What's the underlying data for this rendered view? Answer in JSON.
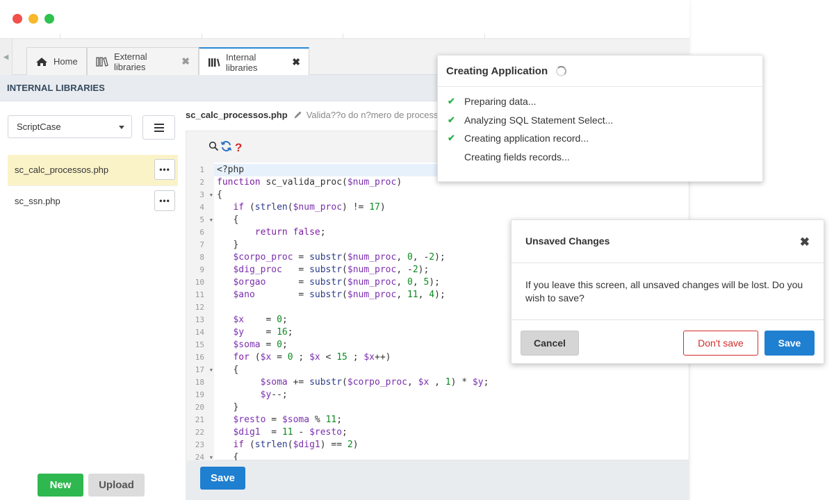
{
  "tabs": [
    {
      "label": "Home",
      "icon": "home-icon",
      "closable": false
    },
    {
      "label": "External libraries",
      "icon": "library-icon",
      "closable": true
    },
    {
      "label": "Internal libraries",
      "icon": "books-icon",
      "closable": true,
      "active": true
    }
  ],
  "section_title": "INTERNAL LIBRARIES",
  "sidebar": {
    "select_value": "ScriptCase",
    "files": [
      {
        "name": "sc_calc_processos.php",
        "selected": true
      },
      {
        "name": "sc_ssn.php",
        "selected": false
      }
    ],
    "new_label": "New",
    "upload_label": "Upload"
  },
  "editor": {
    "filename": "sc_calc_processos.php",
    "description": "Valida??o do n?mero de processo",
    "tool_question": "?",
    "save_label": "Save",
    "line_numbers": [
      "1",
      "2",
      "3",
      "4",
      "5",
      "6",
      "7",
      "8",
      "9",
      "10",
      "11",
      "12",
      "13",
      "14",
      "15",
      "16",
      "17",
      "18",
      "19",
      "20",
      "21",
      "22",
      "23",
      "24"
    ],
    "folds": [
      "3",
      "5",
      "17",
      "24"
    ],
    "lines": [
      "<?php",
      "function sc_valida_proc($num_proc)",
      "{",
      "   if (strlen($num_proc) != 17)",
      "   {",
      "       return false;",
      "   }",
      "   $corpo_proc = substr($num_proc, 0, -2);",
      "   $dig_proc   = substr($num_proc, -2);",
      "   $orgao      = substr($num_proc, 0, 5);",
      "   $ano        = substr($num_proc, 11, 4);",
      "",
      "   $x    = 0;",
      "   $y    = 16;",
      "   $soma = 0;",
      "   for ($x = 0 ; $x < 15 ; $x++)",
      "   {",
      "        $soma += substr($corpo_proc, $x , 1) * $y;",
      "        $y--;",
      "   }",
      "   $resto = $soma % 11;",
      "   $dig1  = 11 - $resto;",
      "   if (strlen($dig1) == 2)",
      "   {"
    ]
  },
  "creating_dialog": {
    "title": "Creating Application",
    "steps": [
      {
        "label": "Preparing data...",
        "done": true
      },
      {
        "label": "Analyzing SQL Statement Select...",
        "done": true
      },
      {
        "label": "Creating application record...",
        "done": true
      },
      {
        "label": "Creating fields records...",
        "done": false
      }
    ],
    "check_glyph": "✔"
  },
  "unsaved_dialog": {
    "title": "Unsaved Changes",
    "message": "If you leave this screen, all unsaved changes will be lost. Do you wish to save?",
    "cancel_label": "Cancel",
    "dont_save_label": "Don't save",
    "save_label": "Save"
  },
  "colors": {
    "accent_blue": "#1f7fd0",
    "new_green": "#2eb84f",
    "danger_red": "#d22b2b",
    "selected_file_bg": "#fbf3c8"
  }
}
